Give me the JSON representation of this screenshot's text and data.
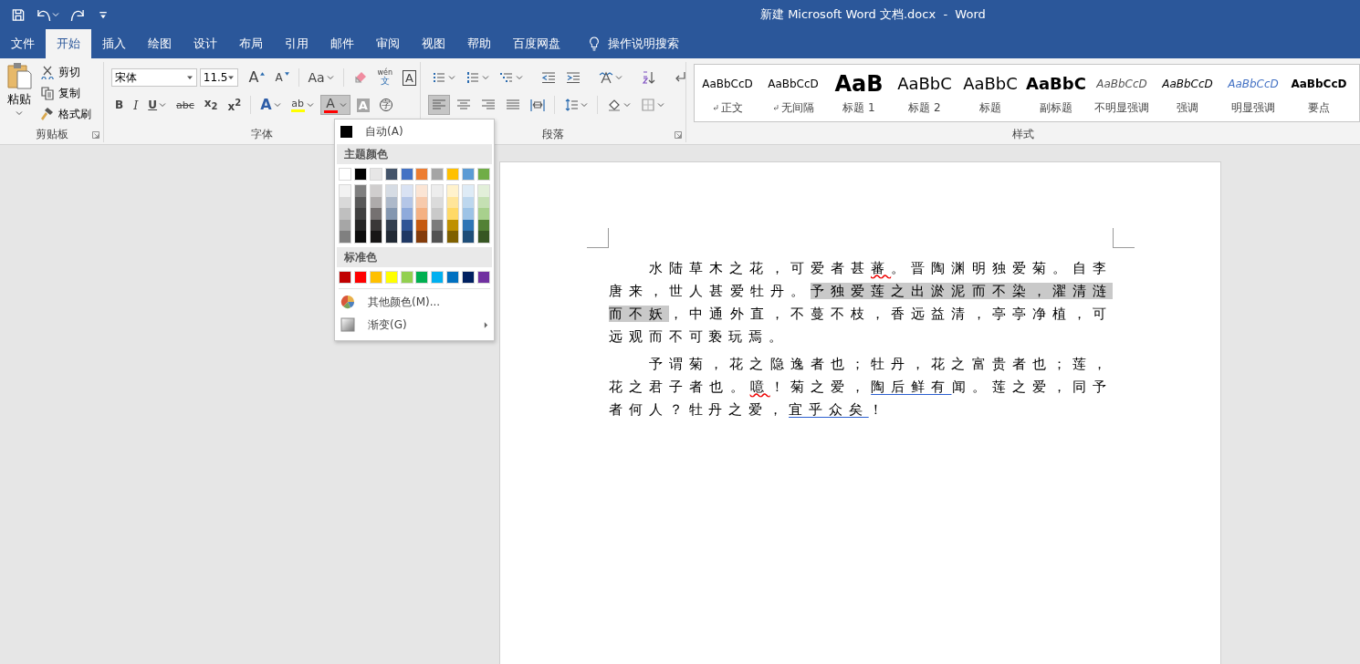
{
  "window": {
    "title": "新建 Microsoft Word 文档.docx  -  Word"
  },
  "quick_access": [
    {
      "kind": "save",
      "dropdown": false
    },
    {
      "kind": "undo",
      "dropdown": true
    },
    {
      "kind": "redo",
      "dropdown": false
    },
    {
      "kind": "customize",
      "dropdown": false
    }
  ],
  "tabs": [
    {
      "label": "文件",
      "selected": false
    },
    {
      "label": "开始",
      "selected": true
    },
    {
      "label": "插入",
      "selected": false
    },
    {
      "label": "绘图",
      "selected": false
    },
    {
      "label": "设计",
      "selected": false
    },
    {
      "label": "布局",
      "selected": false
    },
    {
      "label": "引用",
      "selected": false
    },
    {
      "label": "邮件",
      "selected": false
    },
    {
      "label": "审阅",
      "selected": false
    },
    {
      "label": "视图",
      "selected": false
    },
    {
      "label": "帮助",
      "selected": false
    },
    {
      "label": "百度网盘",
      "selected": false
    }
  ],
  "tell_me": {
    "label": "操作说明搜索"
  },
  "clipboard": {
    "paste": "粘贴",
    "label": "剪贴板",
    "items": [
      {
        "kind": "cut",
        "label": "剪切"
      },
      {
        "kind": "copy",
        "label": "复制"
      },
      {
        "kind": "painter",
        "label": "格式刷"
      }
    ]
  },
  "font": {
    "name": "宋体",
    "size": "11.5",
    "label": "字体",
    "row1": [
      {
        "buttons": [
          {
            "kind": "grow",
            "label": "A",
            "dropdown": false,
            "pressed": false
          },
          {
            "kind": "shrink",
            "label": "A",
            "dropdown": false,
            "pressed": false
          }
        ]
      },
      {
        "buttons": [
          {
            "kind": "case",
            "label": "Aa",
            "dropdown": true,
            "pressed": false
          }
        ]
      },
      {
        "buttons": [
          {
            "kind": "clear",
            "dropdown": false,
            "pressed": false
          },
          {
            "kind": "phonetic",
            "label": "wén",
            "sub": "文",
            "dropdown": false,
            "pressed": false
          },
          {
            "kind": "border",
            "label": "A",
            "dropdown": false,
            "pressed": false
          }
        ]
      }
    ],
    "row2": [
      {
        "buttons": [
          {
            "kind": "bold",
            "label": "B",
            "dropdown": false,
            "pressed": false
          },
          {
            "kind": "italic",
            "label": "I",
            "dropdown": false,
            "pressed": false
          },
          {
            "kind": "underline",
            "label": "U",
            "dropdown": true,
            "pressed": false
          },
          {
            "kind": "strike",
            "label": "abc",
            "dropdown": false,
            "pressed": false
          },
          {
            "kind": "sub",
            "label": "x$_{2}$",
            "dropdown": false,
            "pressed": false
          },
          {
            "kind": "sup",
            "label": "x$^{2}$",
            "dropdown": false,
            "pressed": false
          }
        ]
      },
      {
        "buttons": [
          {
            "kind": "effects",
            "label": "A",
            "dropdown": true,
            "pressed": false
          },
          {
            "kind": "highlight",
            "label": "ab",
            "color": "#ffff00",
            "dropdown": true,
            "pressed": false
          },
          {
            "kind": "font_color",
            "label": "A",
            "color": "#ff0000",
            "dropdown": true,
            "pressed": true
          },
          {
            "kind": "shading",
            "label": "A",
            "dropdown": false,
            "pressed": false
          },
          {
            "kind": "enclosed",
            "label": "字",
            "dropdown": false,
            "pressed": false
          }
        ]
      }
    ]
  },
  "paragraph": {
    "label": "段落",
    "row1": [
      {
        "buttons": [
          {
            "kind": "bullets",
            "dropdown": true,
            "pressed": false
          },
          {
            "kind": "numbering",
            "dropdown": true,
            "pressed": false
          },
          {
            "kind": "multilevel",
            "dropdown": true,
            "pressed": false
          }
        ]
      },
      {
        "buttons": [
          {
            "kind": "outdent",
            "dropdown": false,
            "pressed": false
          },
          {
            "kind": "indent",
            "dropdown": false,
            "pressed": false
          }
        ]
      },
      {
        "buttons": [
          {
            "kind": "cjk",
            "dropdown": true,
            "pressed": false
          }
        ]
      },
      {
        "buttons": [
          {
            "kind": "sort",
            "dropdown": false,
            "pressed": false
          }
        ]
      },
      {
        "buttons": [
          {
            "kind": "marks",
            "dropdown": false,
            "pressed": false
          }
        ]
      }
    ],
    "row2": [
      {
        "buttons": [
          {
            "kind": "left",
            "dropdown": false,
            "pressed": true
          },
          {
            "kind": "center",
            "dropdown": false,
            "pressed": false
          },
          {
            "kind": "right",
            "dropdown": false,
            "pressed": false
          },
          {
            "kind": "justify",
            "dropdown": false,
            "pressed": false
          },
          {
            "kind": "distributed",
            "dropdown": false,
            "pressed": false
          }
        ]
      },
      {
        "buttons": [
          {
            "kind": "spacing",
            "dropdown": true,
            "pressed": false
          }
        ]
      },
      {
        "buttons": [
          {
            "kind": "shading",
            "dropdown": true,
            "pressed": false
          },
          {
            "kind": "borders",
            "dropdown": true,
            "pressed": false
          }
        ]
      }
    ]
  },
  "styles": {
    "label": "样式",
    "items": [
      {
        "kind": "normal",
        "preview": "AaBbCcD",
        "label": "正文",
        "mark": true
      },
      {
        "kind": "normal",
        "preview": "AaBbCcD",
        "label": "无间隔",
        "mark": true
      },
      {
        "kind": "h1",
        "preview": "AaB",
        "label": "标题 1",
        "mark": false
      },
      {
        "kind": "h2",
        "preview": "AaBbC",
        "label": "标题 2",
        "mark": false
      },
      {
        "kind": "title",
        "preview": "AaBbC",
        "label": "标题",
        "mark": false
      },
      {
        "kind": "subtitle",
        "preview": "AaBbC",
        "label": "副标题",
        "mark": false
      },
      {
        "kind": "subtle",
        "preview": "AaBbCcD",
        "label": "不明显强调",
        "mark": false
      },
      {
        "kind": "emphasis",
        "preview": "AaBbCcD",
        "label": "强调",
        "mark": false
      },
      {
        "kind": "intense",
        "preview": "AaBbCcD",
        "label": "明显强调",
        "mark": false
      },
      {
        "kind": "strong",
        "preview": "AaBbCcD",
        "label": "要点",
        "mark": false
      }
    ]
  },
  "color_menu": {
    "open": true,
    "auto": "自动(A)",
    "theme_header": "主题颜色",
    "standard_header": "标准色",
    "more": "其他颜色(M)...",
    "gradient": "渐变(G)",
    "theme": [
      {
        "color": "#ffffff",
        "shades": [
          {
            "color": "#f2f2f2"
          },
          {
            "color": "#d9d9d9"
          },
          {
            "color": "#bfbfbf"
          },
          {
            "color": "#a6a6a6"
          },
          {
            "color": "#808080"
          }
        ]
      },
      {
        "color": "#000000",
        "shades": [
          {
            "color": "#7f7f7f"
          },
          {
            "color": "#595959"
          },
          {
            "color": "#404040"
          },
          {
            "color": "#262626"
          },
          {
            "color": "#0d0d0d"
          }
        ]
      },
      {
        "color": "#e7e6e6",
        "shades": [
          {
            "color": "#d0cece"
          },
          {
            "color": "#aeabab"
          },
          {
            "color": "#757171"
          },
          {
            "color": "#3a3838"
          },
          {
            "color": "#171616"
          }
        ]
      },
      {
        "color": "#44546a",
        "shades": [
          {
            "color": "#d6dce4"
          },
          {
            "color": "#adb9ca"
          },
          {
            "color": "#8497b0"
          },
          {
            "color": "#333f4f"
          },
          {
            "color": "#222a35"
          }
        ]
      },
      {
        "color": "#4472c4",
        "shades": [
          {
            "color": "#d9e2f3"
          },
          {
            "color": "#b4c6e7"
          },
          {
            "color": "#8eaadb"
          },
          {
            "color": "#2f5496"
          },
          {
            "color": "#1f3864"
          }
        ]
      },
      {
        "color": "#ed7d31",
        "shades": [
          {
            "color": "#fbe5d5"
          },
          {
            "color": "#f7caac"
          },
          {
            "color": "#f4b183"
          },
          {
            "color": "#c55a11"
          },
          {
            "color": "#843c0b"
          }
        ]
      },
      {
        "color": "#a5a5a5",
        "shades": [
          {
            "color": "#ededed"
          },
          {
            "color": "#dbdbdb"
          },
          {
            "color": "#c9c9c9"
          },
          {
            "color": "#7b7b7b"
          },
          {
            "color": "#525252"
          }
        ]
      },
      {
        "color": "#ffc000",
        "shades": [
          {
            "color": "#fff2cc"
          },
          {
            "color": "#ffe599"
          },
          {
            "color": "#ffd966"
          },
          {
            "color": "#bf9000"
          },
          {
            "color": "#7f6000"
          }
        ]
      },
      {
        "color": "#5b9bd5",
        "shades": [
          {
            "color": "#deebf6"
          },
          {
            "color": "#bdd7ee"
          },
          {
            "color": "#9dc3e6"
          },
          {
            "color": "#2e75b5"
          },
          {
            "color": "#1f4e79"
          }
        ]
      },
      {
        "color": "#70ad47",
        "shades": [
          {
            "color": "#e2efd9"
          },
          {
            "color": "#c5e0b3"
          },
          {
            "color": "#a8d08d"
          },
          {
            "color": "#538135"
          },
          {
            "color": "#375623"
          }
        ]
      }
    ],
    "standard": [
      {
        "color": "#c00000"
      },
      {
        "color": "#ff0000"
      },
      {
        "color": "#ffc000"
      },
      {
        "color": "#ffff00"
      },
      {
        "color": "#92d050"
      },
      {
        "color": "#00b050"
      },
      {
        "color": "#00b0f0"
      },
      {
        "color": "#0070c0"
      },
      {
        "color": "#002060"
      },
      {
        "color": "#7030a0"
      }
    ]
  },
  "document": {
    "paragraphs": [
      {
        "segments": [
          {
            "kind": "plain",
            "text": "水陆草木之花，可爱者甚"
          },
          {
            "kind": "spelling",
            "text": "蕃"
          },
          {
            "kind": "plain",
            "text": "。晋陶渊明独爱菊。自李唐来，世人甚爱牡丹。"
          },
          {
            "kind": "highlight",
            "text": "予独爱莲之出淤泥而不染，濯清涟而不妖"
          },
          {
            "kind": "plain",
            "text": "，中通外直，不蔓不枝，香远益清，亭亭净植，可远观而不可亵玩焉。"
          }
        ]
      },
      {
        "segments": [
          {
            "kind": "plain",
            "text": "予谓菊，花之隐逸者也；牡丹，花之富贵者也；莲，花之君子者也。"
          },
          {
            "kind": "spelling",
            "text": "噫"
          },
          {
            "kind": "plain",
            "text": "！菊之爱，"
          },
          {
            "kind": "grammar",
            "text": "陶后鲜有"
          },
          {
            "kind": "plain",
            "text": "闻。莲之爱，同予者何人？牡丹之爱，"
          },
          {
            "kind": "grammar",
            "text": "宜乎众矣"
          },
          {
            "kind": "plain",
            "text": "！"
          }
        ]
      }
    ]
  }
}
